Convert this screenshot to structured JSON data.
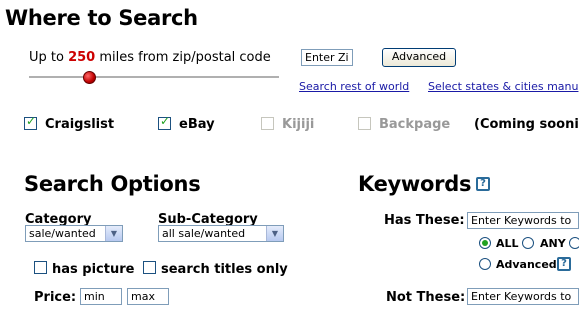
{
  "where": {
    "title": "Where to Search",
    "distance_prefix": "Up to",
    "distance_value": "250",
    "distance_suffix": "miles from zip/postal code",
    "zip_value": "Enter Zip",
    "advanced_label": "Advanced",
    "search_world_link": "Search rest of world",
    "select_states_link": "Select states & cities manu",
    "distance_slider_fraction": 0.24
  },
  "sites": {
    "craigslist": "Craigslist",
    "ebay": "eBay",
    "kijiji": "Kijiji",
    "backpage": "Backpage",
    "coming_soon": "(Coming sooni"
  },
  "options": {
    "title": "Search Options",
    "category_label": "Category",
    "category_value": "sale/wanted",
    "subcategory_label": "Sub-Category",
    "subcategory_value": "all sale/wanted",
    "has_picture": "has picture",
    "titles_only": "search titles only",
    "price_label": "Price:",
    "price_min": "min",
    "price_max": "max"
  },
  "keywords": {
    "title": "Keywords",
    "has_these_label": "Has These:",
    "has_these_value": "Enter Keywords to Sea",
    "all_label": "ALL",
    "any_label": "ANY",
    "advanced_label": "Advanced",
    "not_these_label": "Not These:",
    "not_these_value": "Enter Keywords to Exc"
  },
  "colors": {
    "accent_red": "#cc0000",
    "link_blue": "#1a1aa6",
    "check_green": "#21a121"
  }
}
